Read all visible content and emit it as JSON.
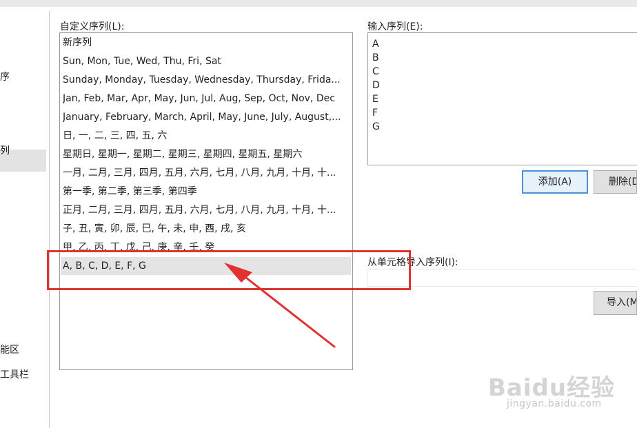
{
  "nav": {
    "items": [
      {
        "label": "序"
      },
      {
        "label": "列"
      },
      {
        "label": "能区"
      },
      {
        "label": "工具栏"
      }
    ]
  },
  "custom_lists": {
    "label": "自定义序列(L):",
    "items": [
      "新序列",
      "Sun, Mon, Tue, Wed, Thu, Fri, Sat",
      "Sunday, Monday, Tuesday, Wednesday, Thursday, Frida...",
      "Jan, Feb, Mar, Apr, May, Jun, Jul, Aug, Sep, Oct, Nov, Dec",
      "January, February, March, April, May, June, July, August,...",
      "日, 一, 二, 三, 四, 五, 六",
      "星期日, 星期一, 星期二, 星期三, 星期四, 星期五, 星期六",
      "一月, 二月, 三月, 四月, 五月, 六月, 七月, 八月, 九月, 十月, 十...",
      "第一季, 第二季, 第三季, 第四季",
      "正月, 二月, 三月, 四月, 五月, 六月, 七月, 八月, 九月, 十月, 十...",
      "子, 丑, 寅, 卯, 辰, 巳, 午, 未, 申, 酉, 戌, 亥",
      "甲, 乙, 丙, 丁, 戊, 己, 庚, 辛, 壬, 癸",
      "A, B, C, D, E, F, G"
    ],
    "selected_index": 12
  },
  "entries": {
    "label": "输入序列(E):",
    "lines": [
      "A",
      "B",
      "C",
      "D",
      "E",
      "F",
      "G"
    ]
  },
  "buttons": {
    "add": "添加(A)",
    "delete": "删除(D",
    "import": "导入(M"
  },
  "import_label": "从单元格导入序列(I):",
  "colors": {
    "highlight": "#e0322e",
    "accent": "#4f8fd6"
  },
  "watermark": {
    "brand": "Baidu经验",
    "url": "jingyan.baidu.com"
  }
}
